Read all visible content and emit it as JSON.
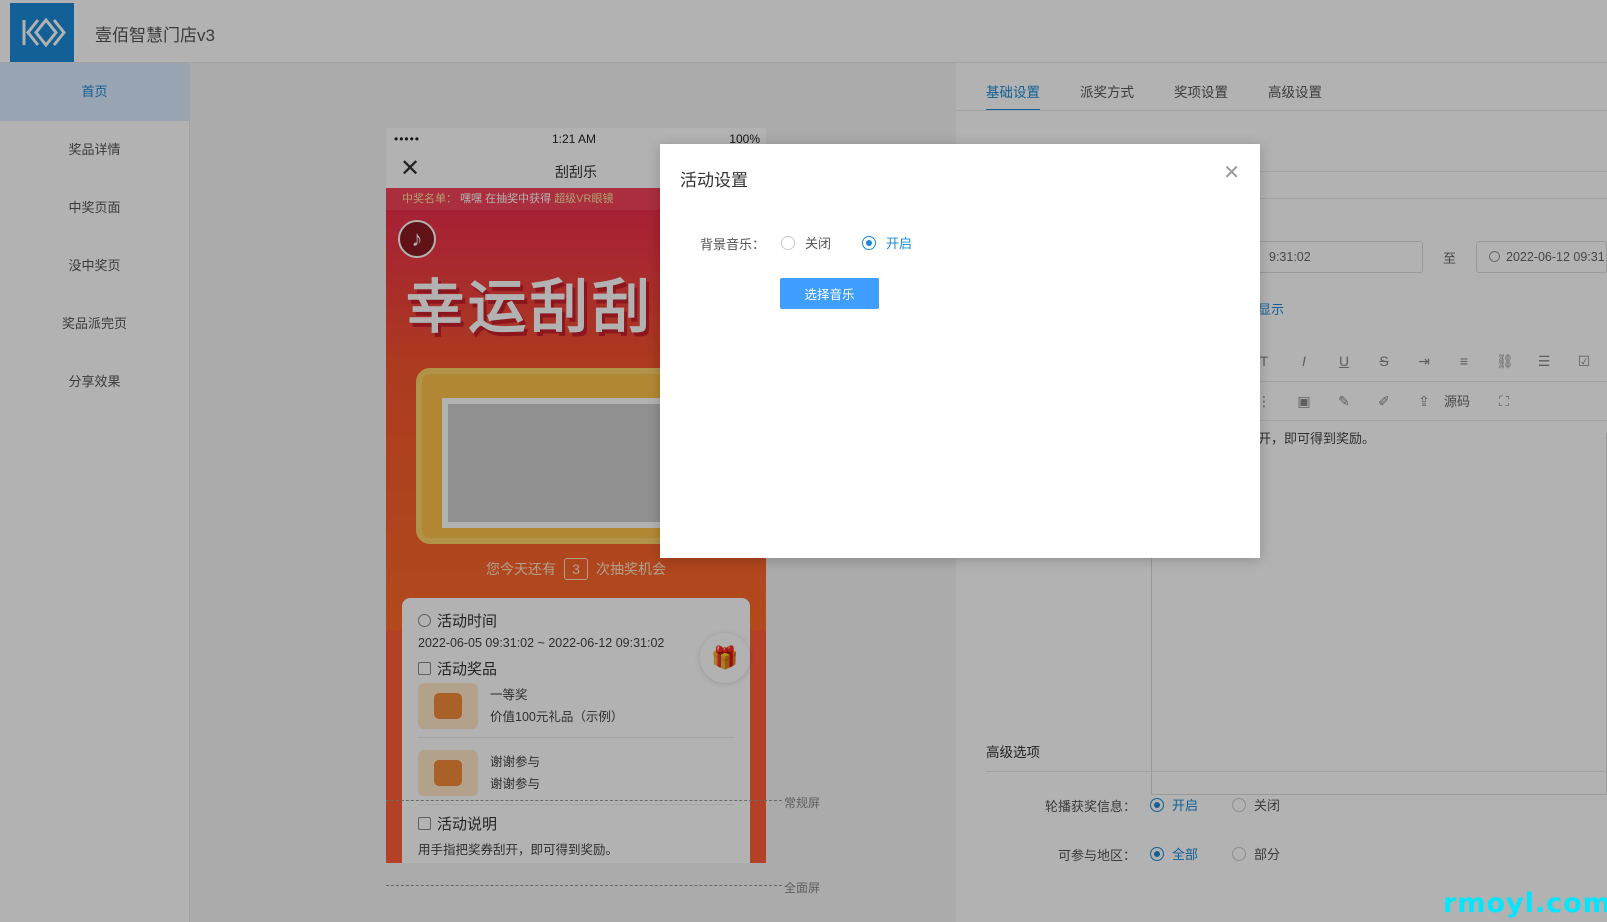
{
  "app": {
    "title": "壹佰智慧门店v3"
  },
  "sidebar": {
    "items": [
      {
        "label": "首页",
        "active": true
      },
      {
        "label": "奖品详情",
        "active": false
      },
      {
        "label": "中奖页面",
        "active": false
      },
      {
        "label": "没中奖页",
        "active": false
      },
      {
        "label": "奖品派完页",
        "active": false
      },
      {
        "label": "分享效果",
        "active": false
      }
    ]
  },
  "phone": {
    "status": {
      "signal": "•••••",
      "time": "1:21 AM",
      "battery": "100%"
    },
    "nav_title": "刮刮乐",
    "marquee": {
      "prefix": "中奖名单：",
      "winner": "嘿嘿 在抽奖中获得",
      "prize": "超级VR眼镜"
    },
    "hero_title": "幸运刮刮",
    "chances": {
      "before": "您今天还有",
      "count": "3",
      "after": "次抽奖机会"
    },
    "activity_time": {
      "title": "活动时间",
      "value": "2022-06-05 09:31:02 ~ 2022-06-12 09:31:02"
    },
    "prizes": {
      "title": "活动奖品",
      "items": [
        {
          "name": "一等奖",
          "desc": "价值100元礼品（示例）"
        },
        {
          "name": "谢谢参与",
          "desc": "谢谢参与"
        }
      ]
    },
    "description": {
      "title": "活动说明",
      "value": "用手指把奖券刮开，即可得到奖励。"
    }
  },
  "guides": {
    "normal": "常规屏",
    "full": "全面屏"
  },
  "settings": {
    "tabs": [
      {
        "label": "基础设置",
        "active": true
      },
      {
        "label": "派奖方式",
        "active": false
      },
      {
        "label": "奖项设置",
        "active": false
      },
      {
        "label": "高级设置",
        "active": false
      }
    ],
    "start_time_partial": "9:31:02",
    "to": "至",
    "end_time": "2022-06-12 09:31",
    "show_link_partial": "显示",
    "source_label": "源码",
    "editor_text_partial": "开，即可得到奖励。",
    "advanced": {
      "title": "高级选项",
      "carousel": {
        "label": "轮播获奖信息：",
        "on": "开启",
        "off": "关闭",
        "value": "on"
      },
      "region": {
        "label": "可参与地区：",
        "all": "全部",
        "part": "部分",
        "value": "all"
      }
    }
  },
  "modal": {
    "title": "活动设置",
    "bg_music": {
      "label": "背景音乐：",
      "off": "关闭",
      "on": "开启",
      "value": "on"
    },
    "select_button": "选择音乐"
  },
  "watermark": "rmoyl.com",
  "colors": {
    "primary": "#1b8ad6",
    "button": "#409eff",
    "hero": "#ff5e3a"
  }
}
